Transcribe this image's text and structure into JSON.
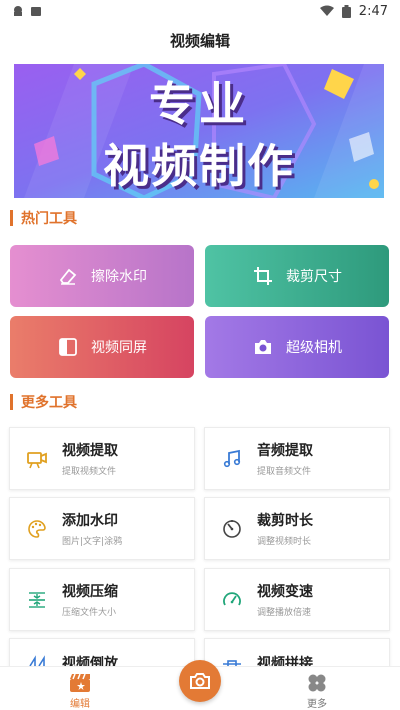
{
  "status_bar": {
    "time": "2:47"
  },
  "header": {
    "title": "视频编辑"
  },
  "banner": {
    "line1": "专业",
    "line2": "视频制作"
  },
  "hot_tools": {
    "section_title": "热门工具",
    "items": [
      {
        "label": "擦除水印",
        "icon": "eraser-icon",
        "color_start": "#e58fd0",
        "color_end": "#b774c9"
      },
      {
        "label": "裁剪尺寸",
        "icon": "crop-icon",
        "color_start": "#4fc3a4",
        "color_end": "#2e9a7c"
      },
      {
        "label": "视频同屏",
        "icon": "split-screen-icon",
        "color_start": "#ea7d6a",
        "color_end": "#d64461"
      },
      {
        "label": "超级相机",
        "icon": "camera-icon",
        "color_start": "#a379e6",
        "color_end": "#7a54d3"
      }
    ]
  },
  "more_tools": {
    "section_title": "更多工具",
    "items": [
      {
        "name": "视频提取",
        "desc": "提取视频文件",
        "icon": "video-camera-icon"
      },
      {
        "name": "音频提取",
        "desc": "提取音频文件",
        "icon": "music-note-icon"
      },
      {
        "name": "添加水印",
        "desc": "图片|文字|涂鸦",
        "icon": "palette-icon"
      },
      {
        "name": "裁剪时长",
        "desc": "调整视频时长",
        "icon": "clock-icon"
      },
      {
        "name": "视频压缩",
        "desc": "压缩文件大小",
        "icon": "compress-icon"
      },
      {
        "name": "视频变速",
        "desc": "调整播放倍速",
        "icon": "speedometer-icon"
      },
      {
        "name": "视频倒放",
        "desc": "",
        "icon": "reverse-icon"
      },
      {
        "name": "视频拼接",
        "desc": "",
        "icon": "join-icon"
      }
    ]
  },
  "bottom_nav": {
    "left_label": "编辑",
    "right_label": "更多",
    "accent": "#e37a35"
  }
}
